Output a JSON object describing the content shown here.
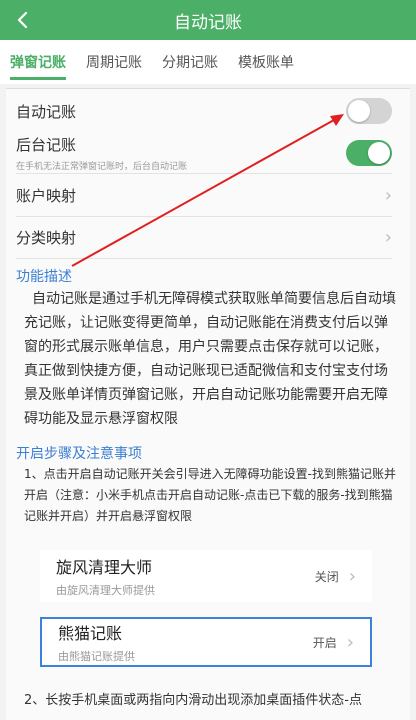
{
  "header": {
    "title": "自动记账"
  },
  "tabs": [
    {
      "label": "弹窗记账"
    },
    {
      "label": "周期记账"
    },
    {
      "label": "分期记账"
    },
    {
      "label": "模板账单"
    }
  ],
  "settings": {
    "auto": {
      "label": "自动记账",
      "state": "off"
    },
    "background": {
      "label": "后台记账",
      "sub": "在手机无法正常弹窗记账时，后台自动记账",
      "state": "on"
    },
    "account_map": {
      "label": "账户映射"
    },
    "category_map": {
      "label": "分类映射"
    }
  },
  "desc_title": "功能描述",
  "description": "自动记账是通过手机无障碍模式获取账单简要信息后自动填充记账，让记账变得更简单，自动记账能在消费支付后以弹窗的形式展示账单信息，用户只需要点击保存就可以记账，真正做到快捷方便，自动记账现已适配微信和支付宝支付场景及账单详情页弹窗记账，开启自动记账功能需要开启无障碍功能及显示悬浮窗权限",
  "steps_title": "开启步骤及注意事项",
  "step1": "1、点击开启自动记账开关会引导进入无障碍功能设置-找到熊猫记账并开启（注意：小米手机点击开启自动记账-点击已下载的服务-找到熊猫记账并开启）并开启悬浮窗权限",
  "cards": [
    {
      "name": "旋风清理大师",
      "sub": "由旋风清理大师提供",
      "status": "关闭"
    },
    {
      "name": "熊猫记账",
      "sub": "由熊猫记账提供",
      "status": "开启"
    }
  ],
  "step2": "2、长按手机桌面或两指向内滑动出现添加桌面插件状态-点",
  "colors": {
    "primary": "#4caf68",
    "link": "#3b7fd4",
    "arrow": "#e02020"
  }
}
